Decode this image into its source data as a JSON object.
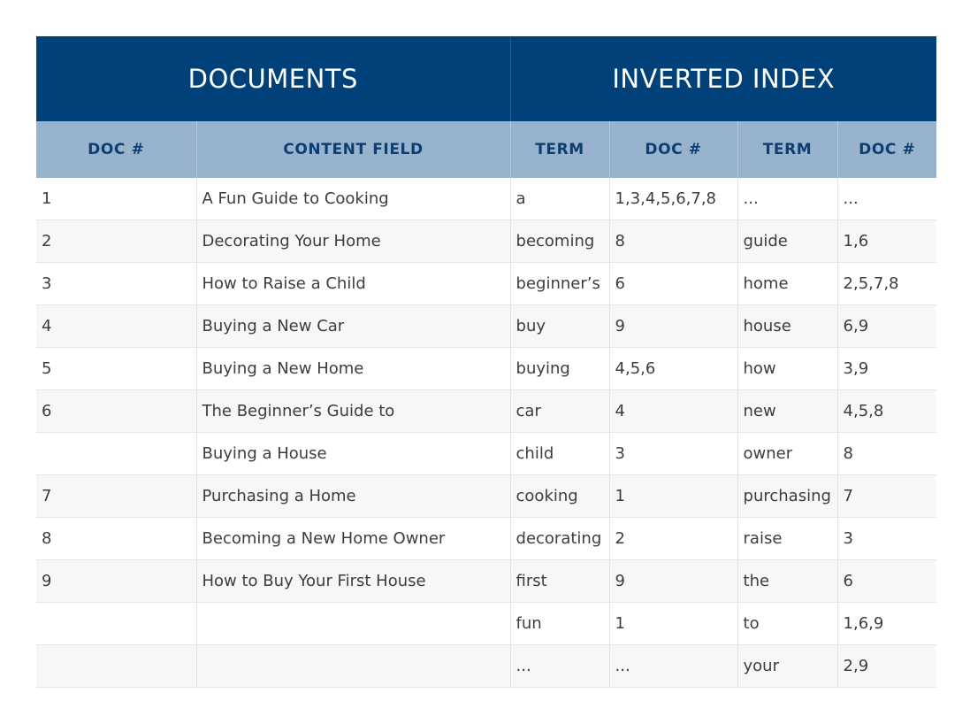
{
  "headers": {
    "documents": "DOCUMENTS",
    "inverted_index": "INVERTED INDEX"
  },
  "columns": [
    "DOC #",
    "CONTENT FIELD",
    "TERM",
    "DOC #",
    "TERM",
    "DOC #"
  ],
  "rows": [
    [
      "1",
      "A Fun Guide to Cooking",
      "a",
      "1,3,4,5,6,7,8",
      "...",
      "..."
    ],
    [
      "2",
      "Decorating Your Home",
      "becoming",
      "8",
      "guide",
      "1,6"
    ],
    [
      "3",
      "How to Raise a Child",
      "beginner’s",
      "6",
      "home",
      "2,5,7,8"
    ],
    [
      "4",
      "Buying a New Car",
      "buy",
      "9",
      "house",
      "6,9"
    ],
    [
      "5",
      "Buying a New Home",
      "buying",
      "4,5,6",
      "how",
      "3,9"
    ],
    [
      "6",
      "The Beginner’s Guide to",
      "car",
      "4",
      "new",
      "4,5,8"
    ],
    [
      "",
      "Buying a House",
      "child",
      "3",
      "owner",
      "8"
    ],
    [
      "7",
      "Purchasing a Home",
      "cooking",
      "1",
      "purchasing",
      "7"
    ],
    [
      "8",
      "Becoming a New Home Owner",
      "decorating",
      "2",
      "raise",
      "3"
    ],
    [
      "9",
      "How to Buy Your First House",
      "first",
      "9",
      "the",
      "6"
    ],
    [
      "",
      "",
      "fun",
      "1",
      "to",
      "1,6,9"
    ],
    [
      "",
      "",
      "...",
      "...",
      "your",
      "2,9"
    ]
  ],
  "colors": {
    "header_dark": "#004179",
    "header_light": "#98b3cd",
    "header_light_text": "#0d3e73",
    "row_alt": "#f6f7f6"
  }
}
